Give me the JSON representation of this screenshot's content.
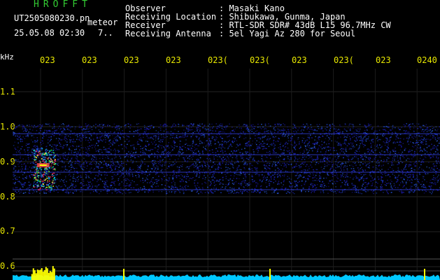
{
  "app": {
    "title": "HROFFT"
  },
  "header": {
    "file_name": "UT2505080230.pn",
    "meteor_label": "meteor",
    "datetime": "25.05.08 02:30",
    "count": "7..",
    "info": [
      {
        "label": "Observer",
        "value": ": Masaki Kano"
      },
      {
        "label": "Receiving Location",
        "value": ": Shibukawa, Gunma, Japan"
      },
      {
        "label": "Receiver",
        "value": ": RTL-SDR SDR# 43dB L15 96.7MHz CW"
      },
      {
        "label": "Receiving Antenna",
        "value": ": 5el Yagi Az 280 for Seoul"
      }
    ]
  },
  "colors": {
    "background": "#000000",
    "header_label": "#ffffff",
    "app_title": "#33cc33",
    "tick_label": "#e8e800",
    "noise": "#1a1aa0",
    "power_trace": "#00c8ff",
    "power_spike": "#ffff00"
  },
  "chart_data": {
    "type": "heatmap",
    "ylabel": "kHz",
    "x_tick_labels": [
      "023",
      "023",
      "023",
      "023",
      "023(",
      "023(",
      "023",
      "023(",
      "023",
      "0240"
    ],
    "y_ticks": [
      "1.1",
      "1.0",
      "0.9",
      "0.8",
      "0.7",
      "0.6"
    ],
    "ylim": [
      0.6,
      1.2
    ],
    "grid": true,
    "noise_band_khz": [
      0.81,
      1.01
    ],
    "carrier_lines_khz": [
      0.92,
      0.87,
      0.82,
      0.98
    ],
    "meteor_echo": {
      "time_fraction": 0.07,
      "freq_khz": [
        0.82,
        0.94
      ],
      "peak_khz": 0.89
    }
  }
}
